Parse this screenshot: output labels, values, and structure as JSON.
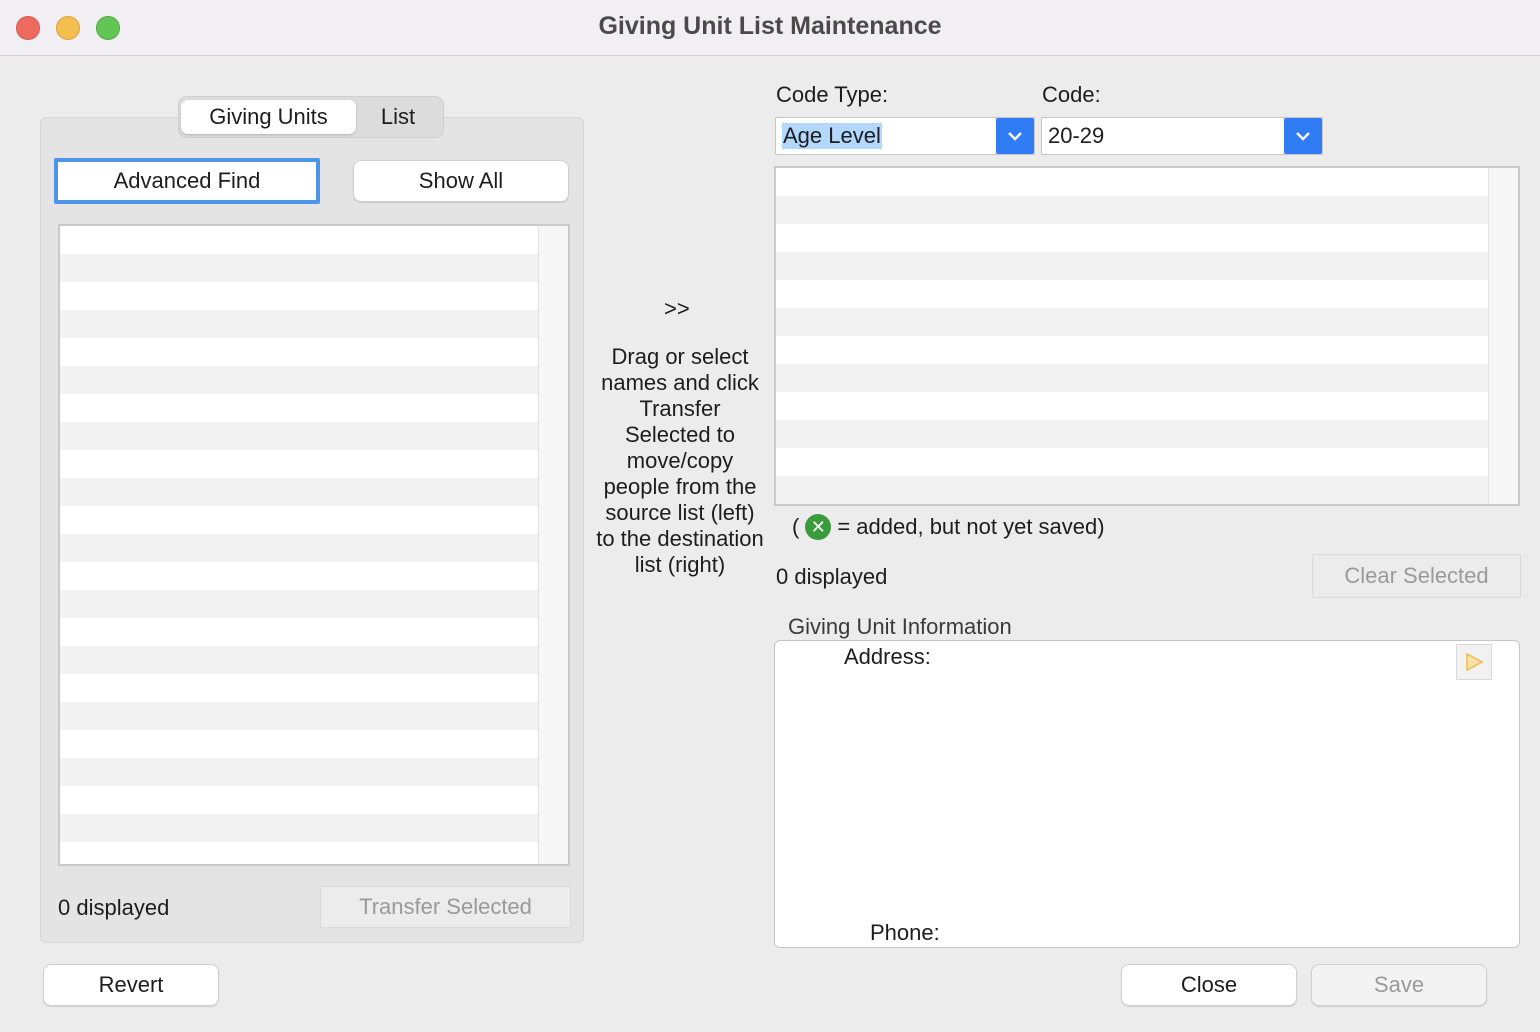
{
  "window": {
    "title": "Giving Unit List Maintenance"
  },
  "tabs": [
    {
      "label": "Giving Units",
      "selected": true
    },
    {
      "label": "List",
      "selected": false
    }
  ],
  "left": {
    "advanced_find_label": "Advanced Find",
    "show_all_label": "Show All",
    "displayed_count": "0 displayed",
    "transfer_selected_label": "Transfer Selected"
  },
  "middle": {
    "arrow_label": ">>",
    "instructions": "Drag or select names and click Transfer Selected to move/copy people from the source list (left) to the destination list (right)"
  },
  "right": {
    "code_type_label": "Code Type:",
    "code_type_value": "Age Level",
    "code_label": "Code:",
    "code_value": "20-29",
    "legend_open": "(",
    "legend_text": "= added, but not yet saved)",
    "displayed_count": "0 displayed",
    "clear_selected_label": "Clear Selected",
    "info_section_title": "Giving Unit Information",
    "address_label": "Address:",
    "phone_label": "Phone:"
  },
  "footer": {
    "revert_label": "Revert",
    "close_label": "Close",
    "save_label": "Save"
  },
  "icons": {
    "legend_icon": "green-x-circle-icon",
    "play_icon": "play-triangle-icon",
    "caret_icon": "chevron-down-icon"
  },
  "colors": {
    "accent": "#2f7cf5",
    "focus_ring": "#4c95e8",
    "close_light": "#ed6a5e",
    "minimize_light": "#f5bf4f",
    "zoom_light": "#62c554",
    "added_marker": "#3a9b3a"
  }
}
